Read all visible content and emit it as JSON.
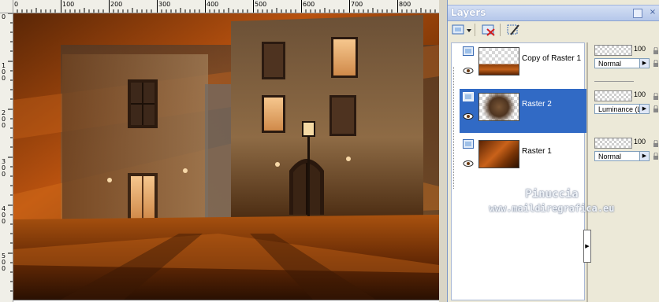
{
  "ruler": {
    "top_labels": [
      "0",
      "100",
      "200",
      "300",
      "400",
      "500",
      "600",
      "700",
      "800"
    ],
    "left_labels": [
      "0",
      "1 0 0",
      "2 0 0",
      "3 0 0",
      "4 0 0",
      "5 0 0"
    ]
  },
  "palette": {
    "title": "Layers",
    "toolbar": {
      "new_layer_icon": "new-layer-icon",
      "delete_icon": "delete-layer-icon",
      "edit_icon": "edit-brush-icon"
    },
    "layers": [
      {
        "name": "Copy of Raster 1",
        "opacity": "100",
        "blend": "Normal",
        "selected": false
      },
      {
        "name": "Raster 2",
        "opacity": "100",
        "blend": "Luminance (L)",
        "selected": true
      },
      {
        "name": "Raster 1",
        "opacity": "100",
        "blend": "Normal",
        "selected": false
      }
    ]
  },
  "watermark": {
    "line1": "Pinuccia",
    "line2": "www.maildiregrafica.eu"
  },
  "colors": {
    "selection": "#316ac5",
    "accent_orange": "#c8581a",
    "palette_bg": "#ece9d8"
  }
}
